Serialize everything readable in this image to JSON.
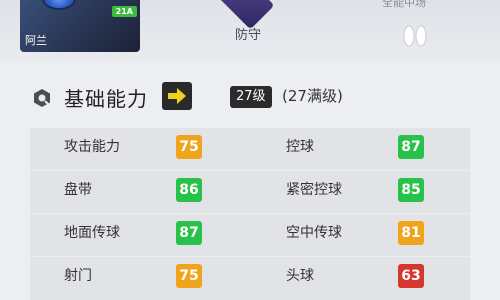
{
  "player_card": {
    "name": "阿兰",
    "badge": "21A"
  },
  "position": {
    "label": "防守"
  },
  "preferred_foot": {
    "top_text": "全能中场"
  },
  "section": {
    "title": "基础能力",
    "icon": "settings-gear-icon",
    "level": "27级",
    "max_level": "(27满级)"
  },
  "stats": [
    {
      "left": {
        "label": "攻击能力",
        "value": "75",
        "color": "yellow"
      },
      "right": {
        "label": "控球",
        "value": "87",
        "color": "green"
      }
    },
    {
      "left": {
        "label": "盘带",
        "value": "86",
        "color": "green"
      },
      "right": {
        "label": "紧密控球",
        "value": "85",
        "color": "green"
      }
    },
    {
      "left": {
        "label": "地面传球",
        "value": "87",
        "color": "green"
      },
      "right": {
        "label": "空中传球",
        "value": "81",
        "color": "yellow"
      }
    },
    {
      "left": {
        "label": "射门",
        "value": "75",
        "color": "yellow"
      },
      "right": {
        "label": "头球",
        "value": "63",
        "color": "red"
      }
    }
  ],
  "colors": {
    "yellow": "#f0a41c",
    "green": "#28c24b",
    "red": "#d5372e"
  }
}
